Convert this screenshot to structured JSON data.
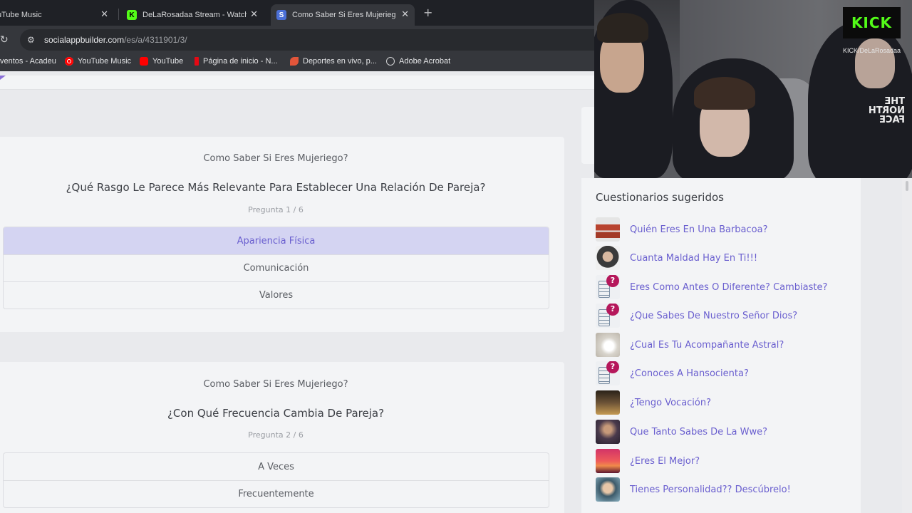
{
  "browser": {
    "tabs": [
      {
        "title": "uTube Music",
        "active": false
      },
      {
        "title": "DeLaRosadaa Stream - Watch L",
        "active": false
      },
      {
        "title": "Como Saber Si Eres Mujeriego?",
        "active": true
      }
    ],
    "close_glyph": "✕",
    "new_tab_glyph": "+",
    "url_host": "socialappbuilder.com",
    "url_path": "/es/a/4311901/3/",
    "bookmarks": [
      {
        "label": "ventos - Acadeu",
        "icon": "none"
      },
      {
        "label": "YouTube Music",
        "icon": "youtube-music-icon"
      },
      {
        "label": "YouTube",
        "icon": "youtube-icon"
      },
      {
        "label": "Página de inicio - N...",
        "icon": "netflix-icon"
      },
      {
        "label": "Deportes en vivo, p...",
        "icon": "leaf-icon"
      },
      {
        "label": "Adobe Acrobat",
        "icon": "globe-icon"
      }
    ]
  },
  "questions": [
    {
      "quiz_name": "Como Saber Si Eres Mujeriego?",
      "question": "¿Qué Rasgo Le Parece Más Relevante Para Establecer Una Relación De Pareja?",
      "counter": "Pregunta 1 / 6",
      "options": [
        "Apariencia Física",
        "Comunicación",
        "Valores"
      ],
      "selected": 0
    },
    {
      "quiz_name": "Como Saber Si Eres Mujeriego?",
      "question": "¿Con Qué Frecuencia Cambia De Pareja?",
      "counter": "Pregunta 2 / 6",
      "options": [
        "A Veces",
        "Frecuentemente"
      ],
      "selected": -1
    }
  ],
  "stream_overlay": {
    "logo": "KICK",
    "handle": "KICK/DeLaRosadaa",
    "shirt_logo": "THE NORTH FACE"
  },
  "suggested": {
    "title": "Cuestionarios sugeridos",
    "items": [
      {
        "label": "Quién Eres En Una Barbacoa?",
        "thumb": "sausage"
      },
      {
        "label": "Cuanta Maldad Hay En Ti!!!",
        "thumb": "nun"
      },
      {
        "label": "Eres Como Antes O Diferente? Cambiaste?",
        "thumb": "doc"
      },
      {
        "label": "¿Que Sabes De Nuestro Señor Dios?",
        "thumb": "doc"
      },
      {
        "label": "¿Cual Es Tu Acompañante Astral?",
        "thumb": "astral"
      },
      {
        "label": "¿Conoces A Hansocienta?",
        "thumb": "doc"
      },
      {
        "label": "¿Tengo Vocación?",
        "thumb": "vocacion"
      },
      {
        "label": "Que Tanto Sabes De La Wwe?",
        "thumb": "wwe"
      },
      {
        "label": "¿Eres El Mejor?",
        "thumb": "sunset"
      },
      {
        "label": "Tienes Personalidad?? Descúbrelo!",
        "thumb": "boy"
      }
    ]
  },
  "colors": {
    "accent": "#6a5fcf",
    "selected_bg": "#d4d4f2",
    "kick_green": "#53fc18",
    "badge": "#b5175b"
  }
}
